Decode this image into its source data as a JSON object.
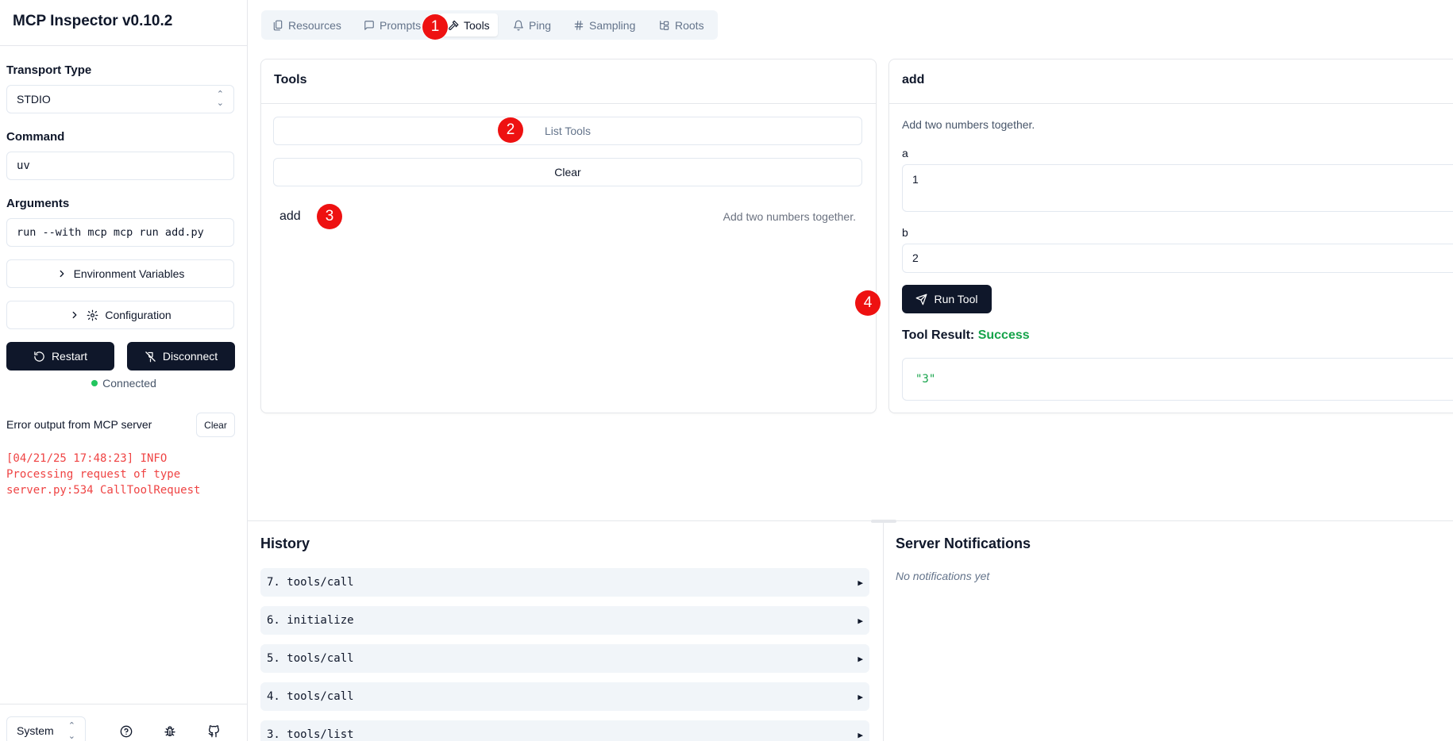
{
  "app": {
    "title": "MCP Inspector v0.10.2"
  },
  "sidebar": {
    "transport_label": "Transport Type",
    "transport_value": "STDIO",
    "command_label": "Command",
    "command_value": "uv",
    "arguments_label": "Arguments",
    "arguments_value": "run --with mcp mcp run add.py",
    "env_button": "Environment Variables",
    "config_button": "Configuration",
    "restart_button": "Restart",
    "disconnect_button": "Disconnect",
    "status": "Connected",
    "error_label": "Error output from MCP server",
    "error_clear": "Clear",
    "error_log": "[04/21/25 17:48:23] INFO\nProcessing request of type\nserver.py:534 CallToolRequest",
    "theme": "System"
  },
  "tabs": [
    {
      "label": "Resources",
      "icon": "files-icon"
    },
    {
      "label": "Prompts",
      "icon": "message-square-icon"
    },
    {
      "label": "Tools",
      "icon": "hammer-icon"
    },
    {
      "label": "Ping",
      "icon": "bell-icon"
    },
    {
      "label": "Sampling",
      "icon": "hash-icon"
    },
    {
      "label": "Roots",
      "icon": "folder-tree-icon"
    }
  ],
  "tools_panel": {
    "title": "Tools",
    "list_button": "List Tools",
    "clear_button": "Clear",
    "items": [
      {
        "name": "add",
        "description": "Add two numbers together."
      }
    ]
  },
  "tool_detail": {
    "title": "add",
    "description": "Add two numbers together.",
    "params": [
      {
        "name": "a",
        "value": "1"
      },
      {
        "name": "b",
        "value": "2"
      }
    ],
    "run_button": "Run Tool",
    "result_label": "Tool Result:",
    "result_status": "Success",
    "result_value": "\"3\""
  },
  "history": {
    "title": "History",
    "items": [
      "7. tools/call",
      "6. initialize",
      "5. tools/call",
      "4. tools/call",
      "3. tools/list"
    ]
  },
  "notifications": {
    "title": "Server Notifications",
    "empty": "No notifications yet"
  },
  "markers": [
    "1",
    "2",
    "3",
    "4"
  ],
  "colors": {
    "primary_dark": "#0f172a",
    "success": "#16a34a",
    "error": "#ef4444",
    "marker": "#ee1111",
    "connected_dot": "#22c55e"
  }
}
